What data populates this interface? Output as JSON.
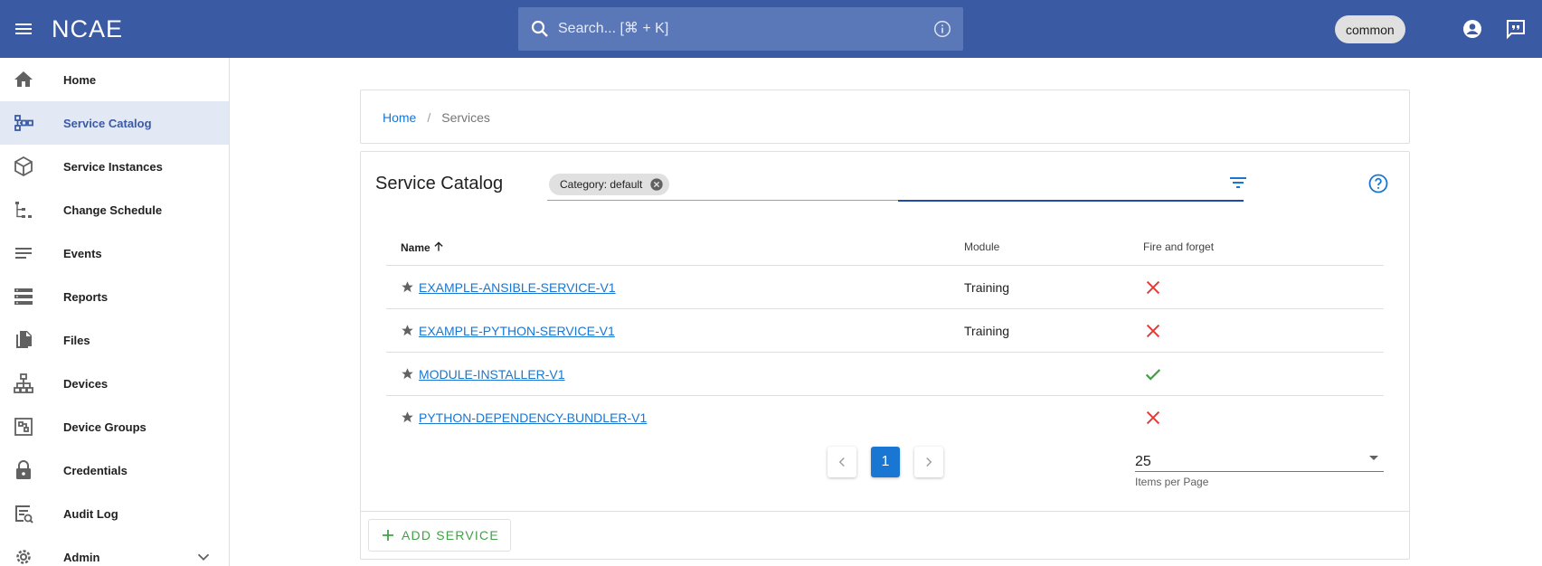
{
  "topbar": {
    "logo": "NCAE",
    "search_placeholder": "Search... [⌘ + K]",
    "context_chip": "common"
  },
  "sidebar": {
    "items": [
      {
        "label": "Home",
        "icon": "home-icon"
      },
      {
        "label": "Service Catalog",
        "icon": "service-catalog-icon",
        "active": true
      },
      {
        "label": "Service Instances",
        "icon": "cube-icon"
      },
      {
        "label": "Change Schedule",
        "icon": "schedule-tree-icon"
      },
      {
        "label": "Events",
        "icon": "lines-icon"
      },
      {
        "label": "Reports",
        "icon": "reports-icon"
      },
      {
        "label": "Files",
        "icon": "files-icon"
      },
      {
        "label": "Devices",
        "icon": "devices-icon"
      },
      {
        "label": "Device Groups",
        "icon": "device-groups-icon"
      },
      {
        "label": "Credentials",
        "icon": "lock-icon"
      },
      {
        "label": "Audit Log",
        "icon": "audit-log-icon"
      },
      {
        "label": "Admin",
        "icon": "gear-icon"
      }
    ]
  },
  "breadcrumb": {
    "home": "Home",
    "separator": "/",
    "current": "Services"
  },
  "catalog": {
    "title": "Service Catalog",
    "filter_chip": "Category: default",
    "columns": {
      "name": "Name",
      "module": "Module",
      "fire_and_forget": "Fire and forget"
    },
    "rows": [
      {
        "name": "EXAMPLE-ANSIBLE-SERVICE-V1",
        "module": "Training",
        "fire_and_forget": false
      },
      {
        "name": "EXAMPLE-PYTHON-SERVICE-V1",
        "module": "Training",
        "fire_and_forget": false
      },
      {
        "name": "MODULE-INSTALLER-V1",
        "module": "",
        "fire_and_forget": true
      },
      {
        "name": "PYTHON-DEPENDENCY-BUNDLER-V1",
        "module": "",
        "fire_and_forget": false
      }
    ],
    "pagination": {
      "current_page": "1"
    },
    "items_per_page": {
      "value": "25",
      "label": "Items per Page"
    },
    "add_button": "ADD SERVICE"
  },
  "colors": {
    "header": "#3a5aa4",
    "link": "#1976d2",
    "fail": "#e53935",
    "success": "#43a047"
  }
}
